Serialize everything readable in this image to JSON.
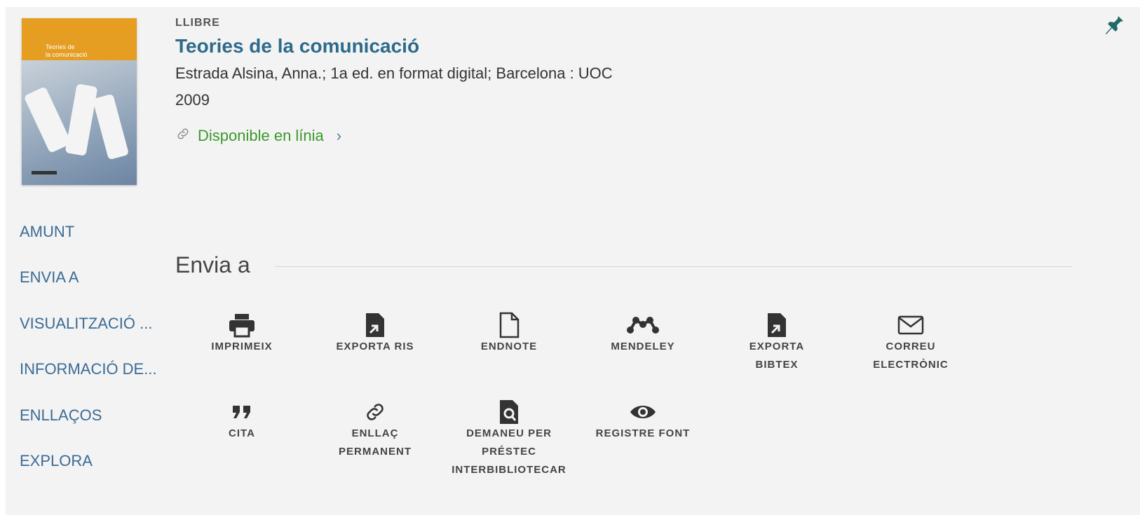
{
  "record": {
    "type": "LLIBRE",
    "title": "Teories de la comunicació",
    "meta": "Estrada Alsina, Anna.; 1a ed. en format digital; Barcelona : UOC",
    "year": "2009",
    "availability": "Disponible en línia",
    "cover_text": "Teories de\nla comunicació"
  },
  "sidebar": {
    "items": [
      {
        "label": "AMUNT"
      },
      {
        "label": "ENVIA A"
      },
      {
        "label": "VISUALITZACIÓ ..."
      },
      {
        "label": "INFORMACIÓ DE..."
      },
      {
        "label": "ENLLAÇOS"
      },
      {
        "label": "EXPLORA"
      }
    ]
  },
  "send_to": {
    "title": "Envia a",
    "actions": [
      {
        "label_line1": "IMPRIMEIX",
        "label_line2": "",
        "label_line3": "",
        "icon": "printer-icon"
      },
      {
        "label_line1": "EXPORTA RIS",
        "label_line2": "",
        "label_line3": "",
        "icon": "export-file-icon"
      },
      {
        "label_line1": "ENDNOTE",
        "label_line2": "",
        "label_line3": "",
        "icon": "document-icon"
      },
      {
        "label_line1": "MENDELEY",
        "label_line2": "",
        "label_line3": "",
        "icon": "mendeley-icon"
      },
      {
        "label_line1": "EXPORTA",
        "label_line2": "BIBTEX",
        "label_line3": "",
        "icon": "export-file-icon"
      },
      {
        "label_line1": "CORREU",
        "label_line2": "ELECTRÒNIC",
        "label_line3": "",
        "icon": "envelope-icon"
      },
      {
        "label_line1": "CITA",
        "label_line2": "",
        "label_line3": "",
        "icon": "quote-icon"
      },
      {
        "label_line1": "ENLLAÇ",
        "label_line2": "PERMANENT",
        "label_line3": "",
        "icon": "link-icon"
      },
      {
        "label_line1": "DEMANEU PER",
        "label_line2": "PRÉSTEC",
        "label_line3": "INTERBIBLIOTECAR",
        "icon": "file-search-icon"
      },
      {
        "label_line1": "REGISTRE FONT",
        "label_line2": "",
        "label_line3": "",
        "icon": "eye-icon"
      }
    ]
  },
  "colors": {
    "title": "#2d6b8a",
    "available": "#3a9a2b",
    "sidebar": "#3b6b95",
    "pin": "#1f6b6b"
  }
}
